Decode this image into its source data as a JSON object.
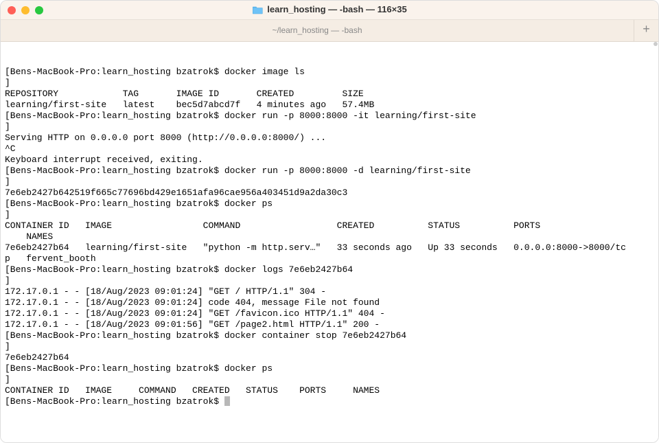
{
  "window": {
    "title": "learn_hosting — -bash — 116×35",
    "tab_label": "~/learn_hosting — -bash",
    "add_tab_symbol": "+"
  },
  "prompt": "Bens-MacBook-Pro:learn_hosting bzatrok$ ",
  "lines": [
    "[Bens-MacBook-Pro:learn_hosting bzatrok$ docker image ls                                                            ]",
    "REPOSITORY            TAG       IMAGE ID       CREATED         SIZE",
    "learning/first-site   latest    bec5d7abcd7f   4 minutes ago   57.4MB",
    "[Bens-MacBook-Pro:learn_hosting bzatrok$ docker run -p 8000:8000 -it learning/first-site                            ]",
    "Serving HTTP on 0.0.0.0 port 8000 (http://0.0.0.0:8000/) ...",
    "^C",
    "Keyboard interrupt received, exiting.",
    "[Bens-MacBook-Pro:learn_hosting bzatrok$ docker run -p 8000:8000 -d learning/first-site                             ]",
    "7e6eb2427b642519f665c77696bd429e1651afa96cae956a403451d9a2da30c3",
    "[Bens-MacBook-Pro:learn_hosting bzatrok$ docker ps                                                                  ]",
    "CONTAINER ID   IMAGE                 COMMAND                  CREATED          STATUS          PORTS                    NAMES",
    "7e6eb2427b64   learning/first-site   \"python -m http.serv…\"   33 seconds ago   Up 33 seconds   0.0.0.0:8000->8000/tcp   fervent_booth",
    "[Bens-MacBook-Pro:learn_hosting bzatrok$ docker logs 7e6eb2427b64                                                   ]",
    "172.17.0.1 - - [18/Aug/2023 09:01:24] \"GET / HTTP/1.1\" 304 -",
    "172.17.0.1 - - [18/Aug/2023 09:01:24] code 404, message File not found",
    "172.17.0.1 - - [18/Aug/2023 09:01:24] \"GET /favicon.ico HTTP/1.1\" 404 -",
    "172.17.0.1 - - [18/Aug/2023 09:01:56] \"GET /page2.html HTTP/1.1\" 200 -",
    "[Bens-MacBook-Pro:learn_hosting bzatrok$ docker container stop 7e6eb2427b64                                         ]",
    "7e6eb2427b64",
    "[Bens-MacBook-Pro:learn_hosting bzatrok$ docker ps                                                                  ]",
    "CONTAINER ID   IMAGE     COMMAND   CREATED   STATUS    PORTS     NAMES"
  ],
  "terminal_width_cols": 116,
  "colors": {
    "titlebar_bg": "#faf3ec",
    "tabbar_bg": "#f5ede4",
    "close": "#ff5f57",
    "minimize": "#febc2e",
    "maximize": "#28c840"
  }
}
